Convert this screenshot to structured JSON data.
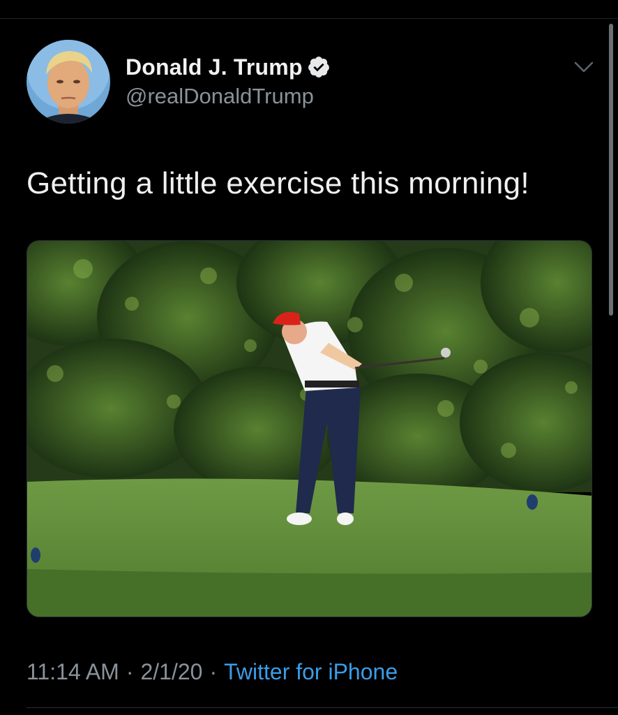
{
  "tweet": {
    "author": {
      "display_name": "Donald J. Trump",
      "handle": "@realDonaldTrump",
      "verified": true,
      "avatar_icon": "profile-photo"
    },
    "text": "Getting a little exercise this morning!",
    "media": {
      "icon": "photo-golfer-swinging-club"
    },
    "time": "11:14 AM",
    "date": "2/1/20",
    "separator": "·",
    "source": "Twitter for iPhone"
  },
  "colors": {
    "background": "#000000",
    "text_primary": "#f0f0f0",
    "text_secondary": "#8b9299",
    "link": "#3b9de8",
    "verified_badge": "#e7e9ea"
  }
}
